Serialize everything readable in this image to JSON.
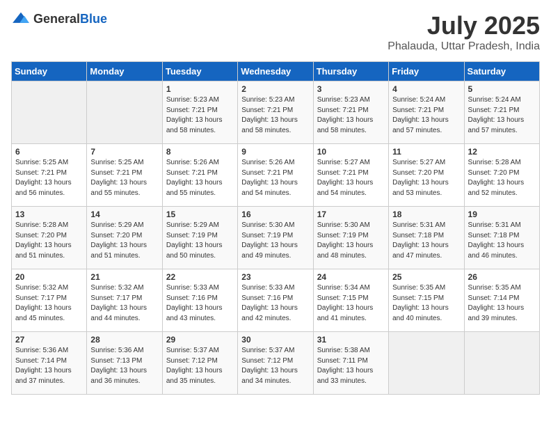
{
  "header": {
    "logo_general": "General",
    "logo_blue": "Blue",
    "title": "July 2025",
    "subtitle": "Phalauda, Uttar Pradesh, India"
  },
  "weekdays": [
    "Sunday",
    "Monday",
    "Tuesday",
    "Wednesday",
    "Thursday",
    "Friday",
    "Saturday"
  ],
  "weeks": [
    [
      {
        "day": "",
        "empty": true
      },
      {
        "day": "",
        "empty": true
      },
      {
        "day": "1",
        "sunrise": "Sunrise: 5:23 AM",
        "sunset": "Sunset: 7:21 PM",
        "daylight": "Daylight: 13 hours and 58 minutes."
      },
      {
        "day": "2",
        "sunrise": "Sunrise: 5:23 AM",
        "sunset": "Sunset: 7:21 PM",
        "daylight": "Daylight: 13 hours and 58 minutes."
      },
      {
        "day": "3",
        "sunrise": "Sunrise: 5:23 AM",
        "sunset": "Sunset: 7:21 PM",
        "daylight": "Daylight: 13 hours and 58 minutes."
      },
      {
        "day": "4",
        "sunrise": "Sunrise: 5:24 AM",
        "sunset": "Sunset: 7:21 PM",
        "daylight": "Daylight: 13 hours and 57 minutes."
      },
      {
        "day": "5",
        "sunrise": "Sunrise: 5:24 AM",
        "sunset": "Sunset: 7:21 PM",
        "daylight": "Daylight: 13 hours and 57 minutes."
      }
    ],
    [
      {
        "day": "6",
        "sunrise": "Sunrise: 5:25 AM",
        "sunset": "Sunset: 7:21 PM",
        "daylight": "Daylight: 13 hours and 56 minutes."
      },
      {
        "day": "7",
        "sunrise": "Sunrise: 5:25 AM",
        "sunset": "Sunset: 7:21 PM",
        "daylight": "Daylight: 13 hours and 55 minutes."
      },
      {
        "day": "8",
        "sunrise": "Sunrise: 5:26 AM",
        "sunset": "Sunset: 7:21 PM",
        "daylight": "Daylight: 13 hours and 55 minutes."
      },
      {
        "day": "9",
        "sunrise": "Sunrise: 5:26 AM",
        "sunset": "Sunset: 7:21 PM",
        "daylight": "Daylight: 13 hours and 54 minutes."
      },
      {
        "day": "10",
        "sunrise": "Sunrise: 5:27 AM",
        "sunset": "Sunset: 7:21 PM",
        "daylight": "Daylight: 13 hours and 54 minutes."
      },
      {
        "day": "11",
        "sunrise": "Sunrise: 5:27 AM",
        "sunset": "Sunset: 7:20 PM",
        "daylight": "Daylight: 13 hours and 53 minutes."
      },
      {
        "day": "12",
        "sunrise": "Sunrise: 5:28 AM",
        "sunset": "Sunset: 7:20 PM",
        "daylight": "Daylight: 13 hours and 52 minutes."
      }
    ],
    [
      {
        "day": "13",
        "sunrise": "Sunrise: 5:28 AM",
        "sunset": "Sunset: 7:20 PM",
        "daylight": "Daylight: 13 hours and 51 minutes."
      },
      {
        "day": "14",
        "sunrise": "Sunrise: 5:29 AM",
        "sunset": "Sunset: 7:20 PM",
        "daylight": "Daylight: 13 hours and 51 minutes."
      },
      {
        "day": "15",
        "sunrise": "Sunrise: 5:29 AM",
        "sunset": "Sunset: 7:19 PM",
        "daylight": "Daylight: 13 hours and 50 minutes."
      },
      {
        "day": "16",
        "sunrise": "Sunrise: 5:30 AM",
        "sunset": "Sunset: 7:19 PM",
        "daylight": "Daylight: 13 hours and 49 minutes."
      },
      {
        "day": "17",
        "sunrise": "Sunrise: 5:30 AM",
        "sunset": "Sunset: 7:19 PM",
        "daylight": "Daylight: 13 hours and 48 minutes."
      },
      {
        "day": "18",
        "sunrise": "Sunrise: 5:31 AM",
        "sunset": "Sunset: 7:18 PM",
        "daylight": "Daylight: 13 hours and 47 minutes."
      },
      {
        "day": "19",
        "sunrise": "Sunrise: 5:31 AM",
        "sunset": "Sunset: 7:18 PM",
        "daylight": "Daylight: 13 hours and 46 minutes."
      }
    ],
    [
      {
        "day": "20",
        "sunrise": "Sunrise: 5:32 AM",
        "sunset": "Sunset: 7:17 PM",
        "daylight": "Daylight: 13 hours and 45 minutes."
      },
      {
        "day": "21",
        "sunrise": "Sunrise: 5:32 AM",
        "sunset": "Sunset: 7:17 PM",
        "daylight": "Daylight: 13 hours and 44 minutes."
      },
      {
        "day": "22",
        "sunrise": "Sunrise: 5:33 AM",
        "sunset": "Sunset: 7:16 PM",
        "daylight": "Daylight: 13 hours and 43 minutes."
      },
      {
        "day": "23",
        "sunrise": "Sunrise: 5:33 AM",
        "sunset": "Sunset: 7:16 PM",
        "daylight": "Daylight: 13 hours and 42 minutes."
      },
      {
        "day": "24",
        "sunrise": "Sunrise: 5:34 AM",
        "sunset": "Sunset: 7:15 PM",
        "daylight": "Daylight: 13 hours and 41 minutes."
      },
      {
        "day": "25",
        "sunrise": "Sunrise: 5:35 AM",
        "sunset": "Sunset: 7:15 PM",
        "daylight": "Daylight: 13 hours and 40 minutes."
      },
      {
        "day": "26",
        "sunrise": "Sunrise: 5:35 AM",
        "sunset": "Sunset: 7:14 PM",
        "daylight": "Daylight: 13 hours and 39 minutes."
      }
    ],
    [
      {
        "day": "27",
        "sunrise": "Sunrise: 5:36 AM",
        "sunset": "Sunset: 7:14 PM",
        "daylight": "Daylight: 13 hours and 37 minutes."
      },
      {
        "day": "28",
        "sunrise": "Sunrise: 5:36 AM",
        "sunset": "Sunset: 7:13 PM",
        "daylight": "Daylight: 13 hours and 36 minutes."
      },
      {
        "day": "29",
        "sunrise": "Sunrise: 5:37 AM",
        "sunset": "Sunset: 7:12 PM",
        "daylight": "Daylight: 13 hours and 35 minutes."
      },
      {
        "day": "30",
        "sunrise": "Sunrise: 5:37 AM",
        "sunset": "Sunset: 7:12 PM",
        "daylight": "Daylight: 13 hours and 34 minutes."
      },
      {
        "day": "31",
        "sunrise": "Sunrise: 5:38 AM",
        "sunset": "Sunset: 7:11 PM",
        "daylight": "Daylight: 13 hours and 33 minutes."
      },
      {
        "day": "",
        "empty": true
      },
      {
        "day": "",
        "empty": true
      }
    ]
  ]
}
